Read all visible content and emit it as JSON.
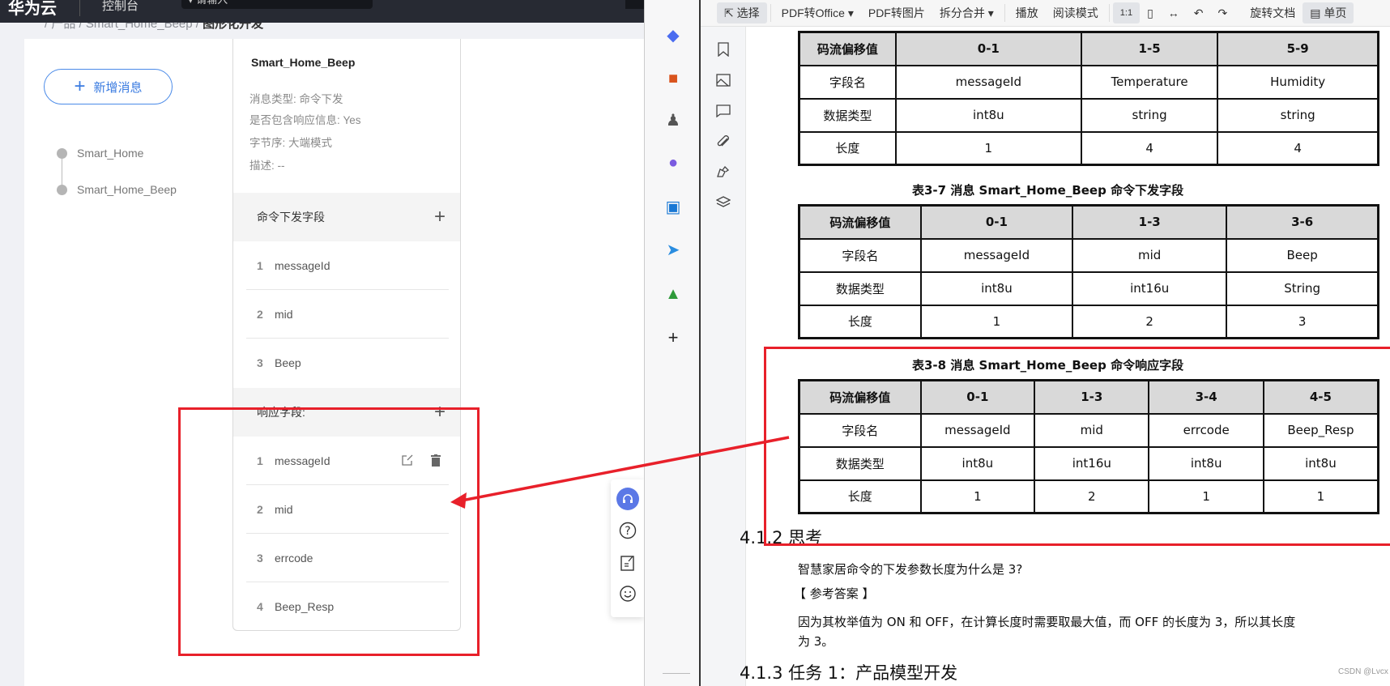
{
  "topbar": {
    "logo": "华为云",
    "console": "控制台",
    "search": "▾ 请输入"
  },
  "breadcrumb": [
    "产品",
    "Smart_Home_Beep",
    "图形化开发"
  ],
  "sidebar": {
    "add_button": "新增消息",
    "messages": [
      "Smart_Home",
      "Smart_Home_Beep"
    ]
  },
  "card": {
    "title": "Smart_Home_Beep",
    "info": [
      "消息类型: 命令下发",
      "是否包含响应信息: Yes",
      "字节序: 大端模式",
      "描述: --"
    ],
    "command_section": {
      "label": "命令下发字段",
      "fields": [
        {
          "num": "1",
          "name": "messageId"
        },
        {
          "num": "2",
          "name": "mid"
        },
        {
          "num": "3",
          "name": "Beep"
        }
      ]
    },
    "response_section": {
      "label": "响应字段:",
      "fields": [
        {
          "num": "1",
          "name": "messageId"
        },
        {
          "num": "2",
          "name": "mid"
        },
        {
          "num": "3",
          "name": "errcode"
        },
        {
          "num": "4",
          "name": "Beep_Resp"
        }
      ]
    }
  },
  "float_icons": [
    "headset-icon",
    "help-icon",
    "feedback-icon",
    "smile-icon"
  ],
  "pdf_toolbar": [
    "选择",
    "PDF转Office ▾",
    "PDF转图片",
    "拆分合并 ▾",
    "播放",
    "阅读模式",
    "旋转文档",
    "单页"
  ],
  "tables": [
    {
      "caption": "",
      "rows": [
        [
          "码流偏移值",
          "0-1",
          "1-5",
          "5-9"
        ],
        [
          "字段名",
          "messageId",
          "Temperature",
          "Humidity"
        ],
        [
          "数据类型",
          "int8u",
          "string",
          "string"
        ],
        [
          "长度",
          "1",
          "4",
          "4"
        ]
      ]
    },
    {
      "caption": "表3-7 消息 Smart_Home_Beep 命令下发字段",
      "rows": [
        [
          "码流偏移值",
          "0-1",
          "1-3",
          "3-6"
        ],
        [
          "字段名",
          "messageId",
          "mid",
          "Beep"
        ],
        [
          "数据类型",
          "int8u",
          "int16u",
          "String"
        ],
        [
          "长度",
          "1",
          "2",
          "3"
        ]
      ]
    },
    {
      "caption": "表3-8 消息 Smart_Home_Beep 命令响应字段",
      "rows": [
        [
          "码流偏移值",
          "0-1",
          "1-3",
          "3-4",
          "4-5"
        ],
        [
          "字段名",
          "messageId",
          "mid",
          "errcode",
          "Beep_Resp"
        ],
        [
          "数据类型",
          "int8u",
          "int16u",
          "int8u",
          "int8u"
        ],
        [
          "长度",
          "1",
          "2",
          "1",
          "1"
        ]
      ]
    }
  ],
  "doc": {
    "h_412": "4.1.2 思考",
    "question": "智慧家居命令的下发参数长度为什么是 3?",
    "answer_label": "【 参考答案 】",
    "answer_1": "因为其枚举值为 ON 和 OFF，在计算长度时需要取最大值，而 OFF 的长度为 3，所以其长度",
    "answer_2": "为 3。",
    "h_413": "4.1.3 任务 1：产品模型开发"
  },
  "watermark": "CSDN @Lvcx",
  "colors": {
    "accent": "#3a7be0",
    "annotation": "#e8202a",
    "topbar": "#272a33"
  }
}
